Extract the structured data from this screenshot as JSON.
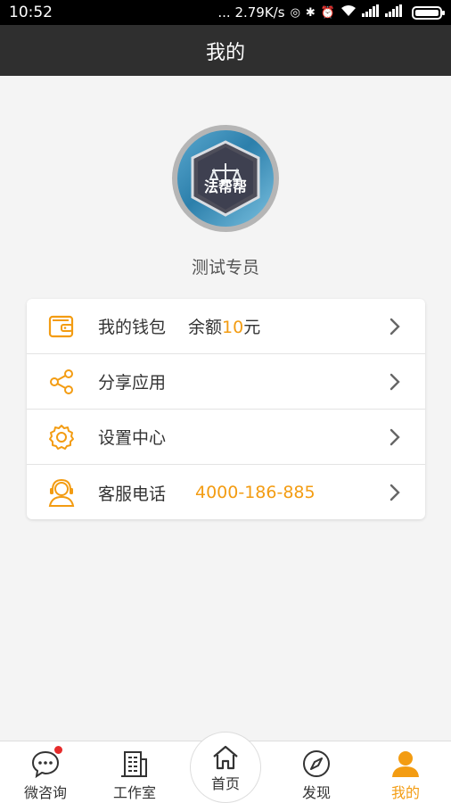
{
  "status_bar": {
    "time": "10:52",
    "speed": "... 2.79K/s",
    "network_label": "4G\n1X"
  },
  "header": {
    "title": "我的"
  },
  "profile": {
    "name": "测试专员",
    "avatar_text": "法帮帮"
  },
  "menu": {
    "wallet": {
      "label": "我的钱包",
      "balance_prefix": "余额",
      "balance_amount": "10",
      "balance_unit": "元"
    },
    "share": {
      "label": "分享应用"
    },
    "settings": {
      "label": "设置中心"
    },
    "service": {
      "label": "客服电话",
      "phone": "4000-186-885"
    }
  },
  "nav": {
    "consult": "微咨询",
    "studio": "工作室",
    "home": "首页",
    "discover": "发现",
    "mine": "我的"
  },
  "colors": {
    "accent": "#f39c12",
    "header_bg": "#2f2f2f",
    "badge": "#e62b2b"
  }
}
